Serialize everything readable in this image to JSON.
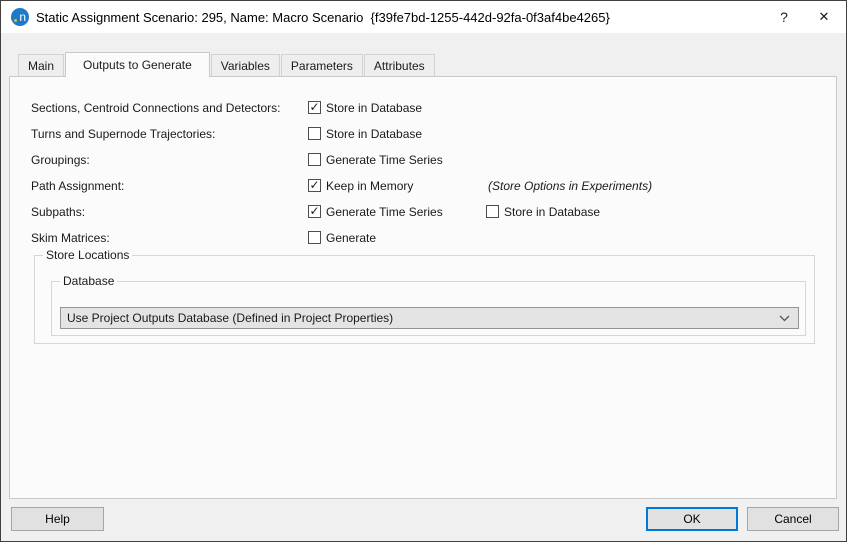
{
  "window": {
    "title": "Static Assignment Scenario: 295, Name: Macro Scenario  {f39fe7bd-1255-442d-92fa-0f3af4be4265}",
    "logo_letter": "n",
    "help_glyph": "?",
    "close_glyph": "✕"
  },
  "tabs": [
    {
      "label": "Main"
    },
    {
      "label": "Outputs to Generate"
    },
    {
      "label": "Variables"
    },
    {
      "label": "Parameters"
    },
    {
      "label": "Attributes"
    }
  ],
  "active_tab": "Outputs to Generate",
  "rows": [
    {
      "label": "Sections, Centroid Connections and Detectors:",
      "options": [
        {
          "label": "Store in Database",
          "checked": true,
          "glyph": "✓"
        }
      ]
    },
    {
      "label": "Turns and Supernode Trajectories:",
      "options": [
        {
          "label": "Store in Database",
          "checked": false,
          "glyph": ""
        }
      ]
    },
    {
      "label": "Groupings:",
      "options": [
        {
          "label": "Generate Time Series",
          "checked": false,
          "glyph": ""
        }
      ]
    },
    {
      "label": "Path Assignment:",
      "options": [
        {
          "label": "Keep in Memory",
          "checked": true,
          "glyph": "✓"
        }
      ],
      "note": "(Store Options in Experiments)"
    },
    {
      "label": "Subpaths:",
      "options": [
        {
          "label": "Generate Time Series",
          "checked": true,
          "glyph": "✓"
        },
        {
          "label": "Store in Database",
          "checked": false,
          "glyph": ""
        }
      ]
    },
    {
      "label": "Skim Matrices:",
      "options": [
        {
          "label": "Generate",
          "checked": false,
          "glyph": ""
        }
      ]
    }
  ],
  "groups": {
    "store_locations_title": "Store Locations",
    "database_title": "Database",
    "database_selected": "Use Project Outputs Database (Defined in Project Properties)"
  },
  "buttons": {
    "help": "Help",
    "ok": "OK",
    "cancel": "Cancel"
  },
  "colors": {
    "accent": "#0078d7",
    "logo_blue": "#1e7ac9",
    "logo_dot": "#d3c41b"
  }
}
